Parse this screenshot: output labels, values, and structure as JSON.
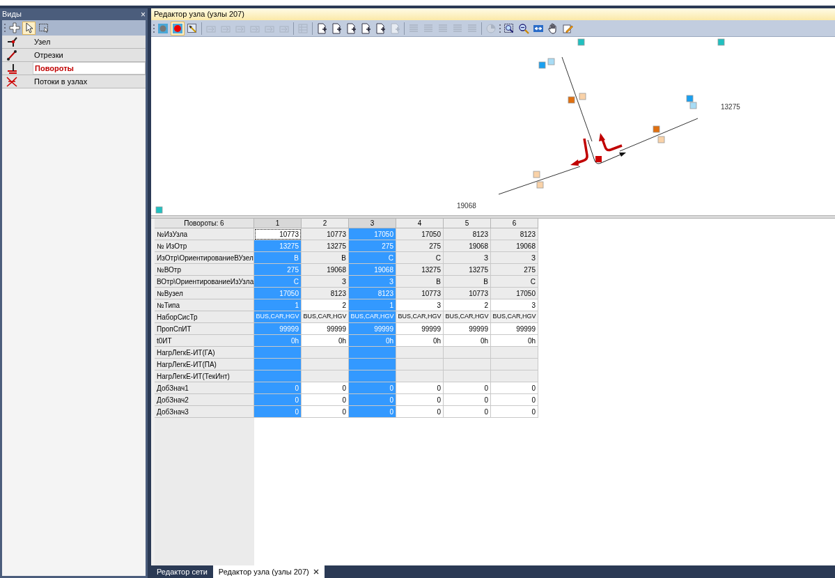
{
  "views_panel": {
    "title": "Виды",
    "close": "×",
    "tools": [
      {
        "kind": "plus",
        "selected": false
      },
      {
        "kind": "pointer",
        "selected": true
      },
      {
        "kind": "rect-select",
        "selected": false
      }
    ],
    "items": [
      {
        "label": "Узел",
        "kind": "node",
        "selected": false
      },
      {
        "label": "Отрезки",
        "kind": "link",
        "selected": false
      },
      {
        "label": "Повороты",
        "kind": "turn",
        "selected": true
      },
      {
        "label": "Потоки в узлах",
        "kind": "flow",
        "selected": false
      }
    ]
  },
  "editor": {
    "title": "Редактор узла (узлы 207)",
    "toolbar": [
      {
        "kind": "grip"
      },
      {
        "kind": "grey-dot",
        "disabled": false,
        "selected": false
      },
      {
        "kind": "red-dot",
        "disabled": false,
        "selected": true
      },
      {
        "kind": "select",
        "disabled": false,
        "selected": false
      },
      {
        "kind": "separator"
      },
      {
        "kind": "los",
        "disabled": true,
        "selected": false
      },
      {
        "kind": "los",
        "disabled": true,
        "selected": false
      },
      {
        "kind": "los",
        "disabled": true,
        "selected": false
      },
      {
        "kind": "los",
        "disabled": true,
        "selected": false
      },
      {
        "kind": "los",
        "disabled": true,
        "selected": false
      },
      {
        "kind": "los",
        "disabled": true,
        "selected": false
      },
      {
        "kind": "separator"
      },
      {
        "kind": "table",
        "disabled": true,
        "selected": false
      },
      {
        "kind": "separator"
      },
      {
        "kind": "doc",
        "disabled": false,
        "selected": false
      },
      {
        "kind": "doc",
        "disabled": false,
        "selected": false
      },
      {
        "kind": "doc",
        "disabled": false,
        "selected": false
      },
      {
        "kind": "doc",
        "disabled": false,
        "selected": false
      },
      {
        "kind": "doc",
        "disabled": false,
        "selected": false
      },
      {
        "kind": "doc",
        "disabled": true,
        "selected": false
      },
      {
        "kind": "separator"
      },
      {
        "kind": "list",
        "disabled": true,
        "selected": false
      },
      {
        "kind": "list",
        "disabled": true,
        "selected": false
      },
      {
        "kind": "list",
        "disabled": true,
        "selected": false
      },
      {
        "kind": "list",
        "disabled": true,
        "selected": false
      },
      {
        "kind": "list",
        "disabled": true,
        "selected": false
      },
      {
        "kind": "separator"
      },
      {
        "kind": "pie",
        "disabled": true,
        "selected": false
      },
      {
        "kind": "grip"
      },
      {
        "kind": "zoom-box",
        "disabled": false,
        "selected": false
      },
      {
        "kind": "zoom",
        "disabled": false,
        "selected": false
      },
      {
        "kind": "fit",
        "disabled": false,
        "selected": false
      },
      {
        "kind": "hand",
        "disabled": false,
        "selected": false
      },
      {
        "kind": "pencil",
        "disabled": false,
        "selected": false
      }
    ],
    "map": {
      "labels": [
        "13275",
        "19068"
      ]
    },
    "table": {
      "corner": "Повороты: 6",
      "columns": [
        {
          "label": "1",
          "selected": true,
          "focused": true
        },
        {
          "label": "2",
          "selected": false,
          "focused": false
        },
        {
          "label": "3",
          "selected": true,
          "focused": false
        },
        {
          "label": "4",
          "selected": false,
          "focused": false
        },
        {
          "label": "5",
          "selected": false,
          "focused": false
        },
        {
          "label": "6",
          "selected": false,
          "focused": false
        }
      ],
      "rows": [
        {
          "label": "№ИзУзла",
          "kind": "readonly",
          "focused": true,
          "cells": [
            "10773",
            "10773",
            "17050",
            "17050",
            "8123",
            "8123"
          ]
        },
        {
          "label": "№ ИзОтр",
          "kind": "readonly",
          "focused": false,
          "cells": [
            "13275",
            "13275",
            "275",
            "275",
            "19068",
            "19068"
          ]
        },
        {
          "label": "ИзОтр\\ОриентированиеВУзел",
          "kind": "readonly",
          "focused": false,
          "cells": [
            "В",
            "В",
            "С",
            "С",
            "З",
            "З"
          ]
        },
        {
          "label": "№ВОтр",
          "kind": "readonly",
          "focused": false,
          "cells": [
            "275",
            "19068",
            "19068",
            "13275",
            "13275",
            "275"
          ]
        },
        {
          "label": "ВОтр\\ОриентированиеИзУзла",
          "kind": "readonly",
          "focused": false,
          "cells": [
            "С",
            "З",
            "З",
            "В",
            "В",
            "С"
          ]
        },
        {
          "label": "№Вузел",
          "kind": "readonly",
          "focused": false,
          "cells": [
            "17050",
            "8123",
            "8123",
            "10773",
            "10773",
            "17050"
          ]
        },
        {
          "label": "№Типа",
          "kind": "editable",
          "focused": false,
          "cells": [
            "1",
            "2",
            "1",
            "3",
            "2",
            "3"
          ]
        },
        {
          "label": "НаборСисТр",
          "kind": "set",
          "focused": false,
          "cells": [
            "BUS,CAR,HGV",
            "BUS,CAR,HGV",
            "BUS,CAR,HGV",
            "BUS,CAR,HGV",
            "BUS,CAR,HGV",
            "BUS,CAR,HGV"
          ]
        },
        {
          "label": "ПропСпИТ",
          "kind": "editable",
          "focused": false,
          "cells": [
            "99999",
            "99999",
            "99999",
            "99999",
            "99999",
            "99999"
          ]
        },
        {
          "label": "t0ИТ",
          "kind": "editable",
          "focused": false,
          "cells": [
            "0h",
            "0h",
            "0h",
            "0h",
            "0h",
            "0h"
          ]
        },
        {
          "label": "НагрЛегкЕ-ИТ(ГА)",
          "kind": "readonly",
          "focused": false
        },
        {
          "label": "НагрЛегкЕ-ИТ(ПА)",
          "kind": "readonly",
          "focused": false
        },
        {
          "label": "НагрЛегкЕ-ИТ(ТекИнт)",
          "kind": "readonly",
          "focused": false
        },
        {
          "label": "ДобЗнач1",
          "kind": "editable",
          "focused": false,
          "cells": [
            "0",
            "0",
            "0",
            "0",
            "0",
            "0"
          ]
        },
        {
          "label": "ДобЗнач2",
          "kind": "editable",
          "focused": false,
          "cells": [
            "0",
            "0",
            "0",
            "0",
            "0",
            "0"
          ]
        },
        {
          "label": "ДобЗнач3",
          "kind": "editable",
          "focused": false,
          "cells": [
            "0",
            "0",
            "0",
            "0",
            "0",
            "0"
          ]
        }
      ]
    }
  },
  "document_tabs": [
    {
      "label": "Редактор сети",
      "selected": false,
      "closable": false
    },
    {
      "label": "Редактор узла (узлы 207)",
      "selected": true,
      "closable": true
    }
  ]
}
